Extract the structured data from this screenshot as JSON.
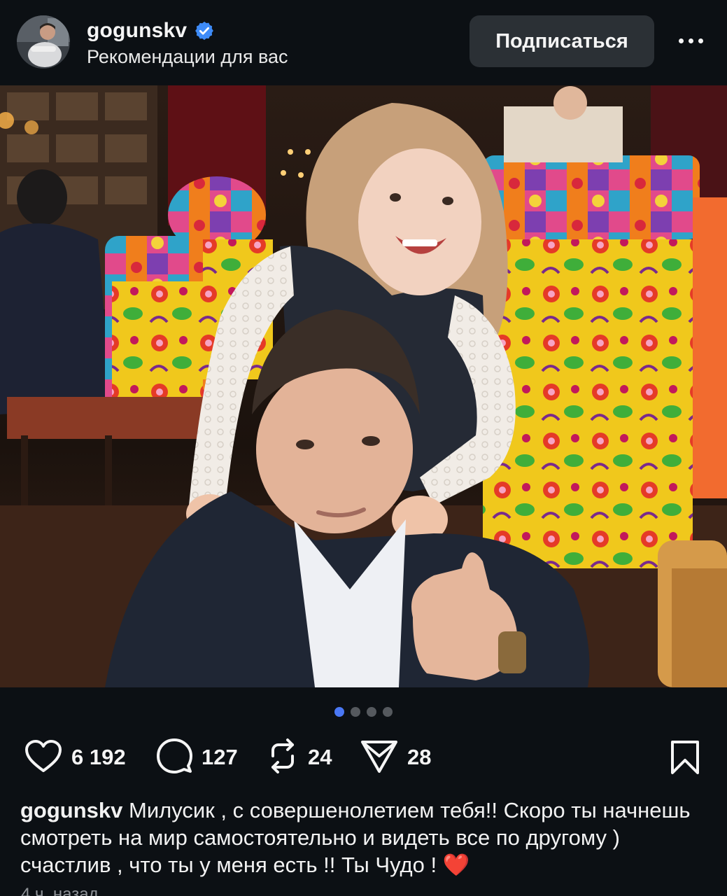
{
  "post_header": {
    "username": "gogunskv",
    "verified_icon": "verified-badge-icon",
    "subtitle": "Рекомендации для вас",
    "follow_label": "Подписаться",
    "more_icon": "more-horizontal-icon"
  },
  "carousel": {
    "total": 4,
    "active_index": 0,
    "active_color": "#4a78f5",
    "inactive_color": "#55595e"
  },
  "actions": {
    "likes": "6 192",
    "comments": "127",
    "reposts": "24",
    "shares": "28",
    "icons": [
      "heart-icon",
      "comment-icon",
      "repost-icon",
      "send-icon",
      "bookmark-icon"
    ]
  },
  "caption": {
    "username": "gogunskv",
    "text": " Милусик , с совершенолетием тебя!! Скоро ты начнешь смотреть на мир самостоятельно и видеть все по другому ) счастлив , что ты у меня есть !! Ты Чудо ! ❤️"
  },
  "timestamp": "4 ч. назад",
  "colors": {
    "background": "#0c1014",
    "button": "#2b3035",
    "text": "#f5f5f5",
    "verified": "#3e8bf7"
  }
}
